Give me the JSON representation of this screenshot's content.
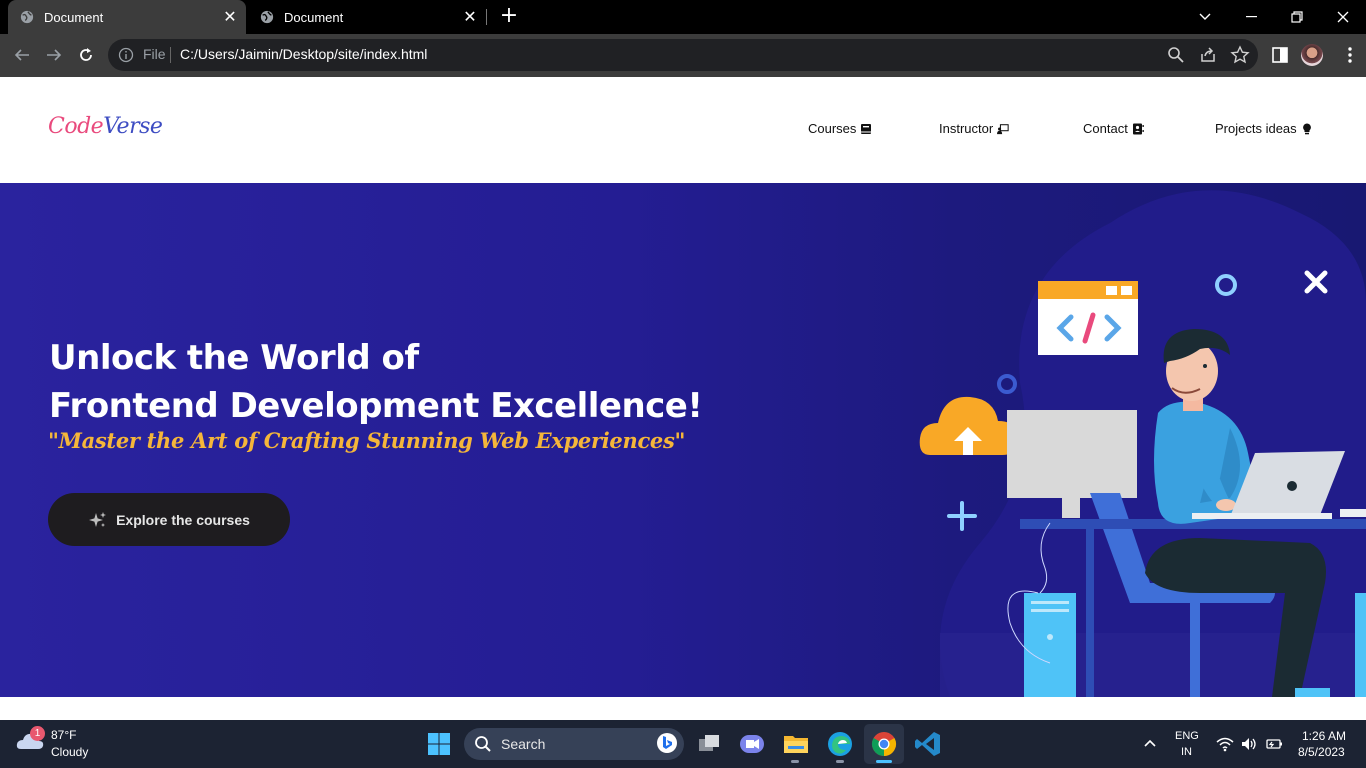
{
  "browser": {
    "tabs": [
      {
        "title": "Document",
        "active": true
      },
      {
        "title": "Document",
        "active": false
      }
    ],
    "address": {
      "scheme_label": "File",
      "url": "C:/Users/Jaimin/Desktop/site/index.html"
    }
  },
  "site": {
    "logo": {
      "part1": "Code",
      "part2": "Verse",
      "color1": "#e94a7d",
      "color2": "#3d4cc2"
    },
    "nav": [
      {
        "label": "Courses",
        "icon": "book-icon"
      },
      {
        "label": "Instructor",
        "icon": "chalkboard-teacher-icon"
      },
      {
        "label": "Contact",
        "icon": "contact-book-icon"
      },
      {
        "label": "Projects ideas",
        "icon": "lightbulb-icon"
      }
    ],
    "hero": {
      "title_line1": "Unlock the World of",
      "title_line2": "Frontend Development Excellence!",
      "subtitle": "\"Master the Art of Crafting Stunning Web Experiences\"",
      "cta_label": "Explore the courses",
      "cta_icon": "sparkles-icon",
      "bg_color": "#241d93",
      "accent_color": "#f5b63a"
    }
  },
  "taskbar": {
    "weather": {
      "temp": "87°F",
      "condition": "Cloudy",
      "badge": "1"
    },
    "search_label": "Search",
    "apps": [
      "task-view-icon",
      "teams-chat-icon",
      "file-explorer-icon",
      "edge-icon",
      "chrome-icon",
      "vscode-icon"
    ],
    "language": {
      "line1": "ENG",
      "line2": "IN"
    },
    "clock": {
      "time": "1:26 AM",
      "date": "8/5/2023"
    }
  }
}
